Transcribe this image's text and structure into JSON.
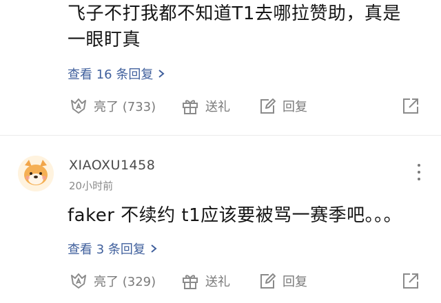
{
  "comment1": {
    "text_line1": "飞子不打我都不知道T1去哪拉赞助，真是",
    "text_line2": "一眼盯真",
    "replies_link": "查看 16 条回复",
    "likes_label": "亮了 (733)",
    "gift_label": "送礼",
    "reply_label": "回复"
  },
  "comment2": {
    "username": "XIAOXU1458",
    "time": "20小时前",
    "text": "faker 不续约 t1应该要被骂一赛季吧。。。",
    "replies_link": "查看 3 条回复",
    "likes_label": "亮了 (329)",
    "gift_label": "送礼",
    "reply_label": "回复"
  },
  "colors": {
    "link": "#3f5f9c",
    "muted": "#7a7a7a",
    "text": "#151515",
    "divider": "#ebebeb"
  },
  "icons": [
    "like-icon",
    "gift-icon",
    "reply-edit-icon",
    "share-icon",
    "more-dots-icon",
    "chevron-right-icon",
    "avatar-dog-icon"
  ]
}
